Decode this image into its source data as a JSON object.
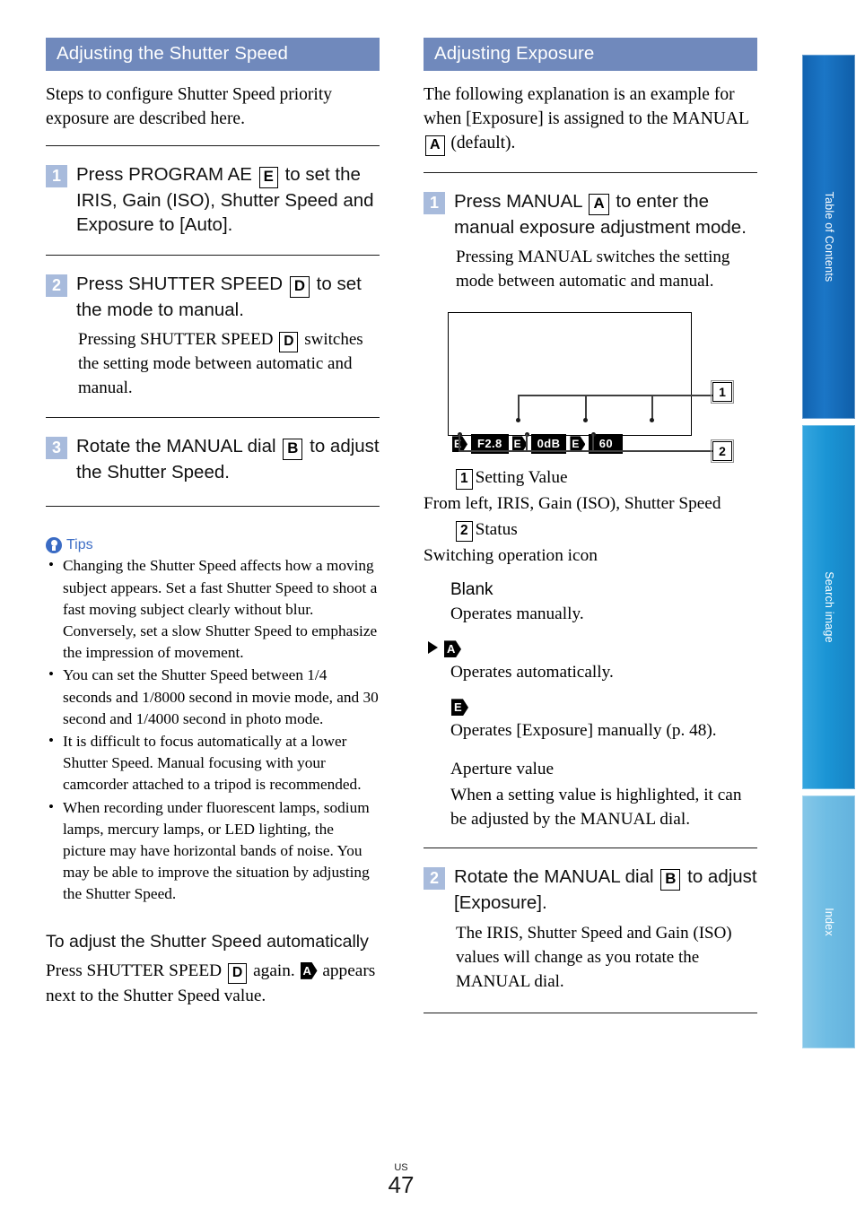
{
  "document": {
    "page_number": "47",
    "region_code": "US"
  },
  "left_column": {
    "heading": "Adjusting the Shutter Speed",
    "intro": "Steps to configure Shutter Speed priority exposure are described here.",
    "steps": [
      {
        "num": "1",
        "title_a": "Press PROGRAM AE",
        "key": "E",
        "title_b": "to set the IRIS, Gain (ISO), Shutter Speed and Exposure to [Auto]."
      },
      {
        "num": "2",
        "title_a": "Press SHUTTER SPEED",
        "key": "D",
        "title_b": "to set the mode to manual.",
        "desc_a": "Pressing SHUTTER SPEED",
        "desc_key": "D",
        "desc_b": "switches the setting mode between automatic and manual."
      },
      {
        "num": "3",
        "title_a": "Rotate the MANUAL dial",
        "key": "B",
        "title_b": "to adjust the Shutter Speed."
      }
    ],
    "tips": {
      "label": "Tips",
      "icon": "lightbulb-icon",
      "items": [
        "Changing the Shutter Speed affects how a moving subject appears. Set a fast Shutter Speed to shoot a fast moving subject clearly without blur. Conversely, set a slow Shutter Speed to emphasize the impression of movement.",
        "You can set the Shutter Speed between 1/4 seconds and 1/8000 second in movie mode, and 30 second and 1/4000 second in photo mode.",
        " It is difficult to focus automatically at a lower Shutter Speed. Manual focusing with your camcorder attached to a tripod is recommended.",
        "When recording under fluorescent lamps, sodium lamps, mercury lamps, or LED lighting, the picture may have horizontal bands of noise. You may be able to improve the situation by adjusting the Shutter Speed."
      ]
    },
    "subsection": {
      "heading": "To adjust the Shutter Speed automatically",
      "text_a": "Press SHUTTER SPEED",
      "key": "D",
      "text_b": "again.",
      "auto_icon": "A",
      "text_c": "appears next to the Shutter Speed value."
    }
  },
  "right_column": {
    "heading": "Adjusting Exposure",
    "intro_a": "The following explanation is an example for when [Exposure] is assigned to the MANUAL",
    "intro_key": "A",
    "intro_b": "(default).",
    "step1": {
      "num": "1",
      "title_a": "Press MANUAL",
      "key": "A",
      "title_b": "to enter the manual exposure adjustment mode.",
      "desc": "Pressing MANUAL switches the setting mode between automatic and manual."
    },
    "diagram": {
      "name": "camera-display-diagram",
      "osd_items": [
        {
          "type": "status-icon",
          "glyph": "E"
        },
        {
          "type": "value",
          "text": "F2.8"
        },
        {
          "type": "status-icon",
          "glyph": "E"
        },
        {
          "type": "value",
          "text": "0dB"
        },
        {
          "type": "status-icon",
          "glyph": "E"
        },
        {
          "type": "value",
          "text": "60"
        }
      ],
      "callouts": [
        "1",
        "2"
      ]
    },
    "legend": {
      "item1_num": "1",
      "item1_label": "Setting Value",
      "item1_desc": "From left, IRIS, Gain (ISO), Shutter Speed",
      "item2_num": "2",
      "item2_label": "Status",
      "item2_desc": "Switching operation icon",
      "blank_label": "Blank",
      "blank_desc": "Operates manually.",
      "auto_icon": "A",
      "auto_desc": "Operates automatically.",
      "exp_icon": "E",
      "exp_desc": "Operates [Exposure] manually (p. 48).",
      "aperture_label": "Aperture value",
      "aperture_desc": "When a setting value is highlighted, it can be adjusted by the MANUAL dial."
    },
    "step2": {
      "num": "2",
      "title_a": "Rotate the MANUAL dial",
      "key": "B",
      "title_b": "to adjust [Exposure].",
      "desc": "The IRIS, Shutter Speed and Gain (ISO) values will change as you rotate the MANUAL dial."
    }
  },
  "side_tabs": [
    {
      "label": "Table of Contents",
      "color": "#1263b0"
    },
    {
      "label": "Search image",
      "color": "#1b95d5"
    },
    {
      "label": "Index",
      "color": "#6fbde4"
    }
  ]
}
